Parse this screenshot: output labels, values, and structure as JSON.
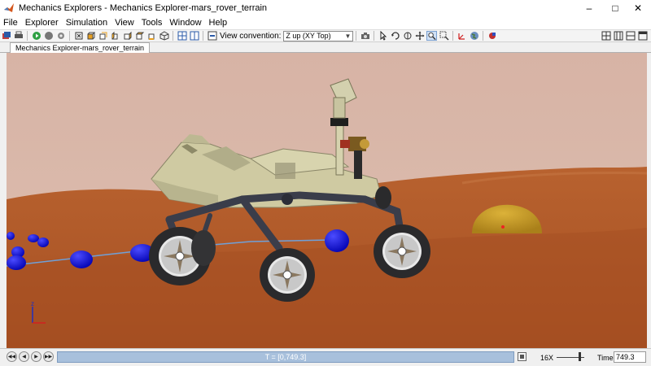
{
  "window": {
    "title": "Mechanics Explorers - Mechanics Explorer-mars_rover_terrain",
    "icons": [
      "matlab-logo-icon",
      "minimize-icon",
      "maximize-icon",
      "close-icon"
    ]
  },
  "menu": [
    "File",
    "Explorer",
    "Simulation",
    "View",
    "Tools",
    "Window",
    "Help"
  ],
  "toolbar": {
    "view_convention_label": "View convention:",
    "view_convention_value": "Z up (XY Top)"
  },
  "tab": {
    "label": "Mechanics Explorer-mars_rover_terrain"
  },
  "playback": {
    "timeline_text": "T = [0,749.3]",
    "speed_label": "16X",
    "time_label": "Time",
    "time_value": "749.3"
  },
  "colors": {
    "sky": "#d9b7a8",
    "terrain": "#b0572a",
    "rover_body": "#cfcba4",
    "marker_blue": "#1010d8",
    "dome": "#c7a126",
    "timeline": "#a8c0dc"
  }
}
